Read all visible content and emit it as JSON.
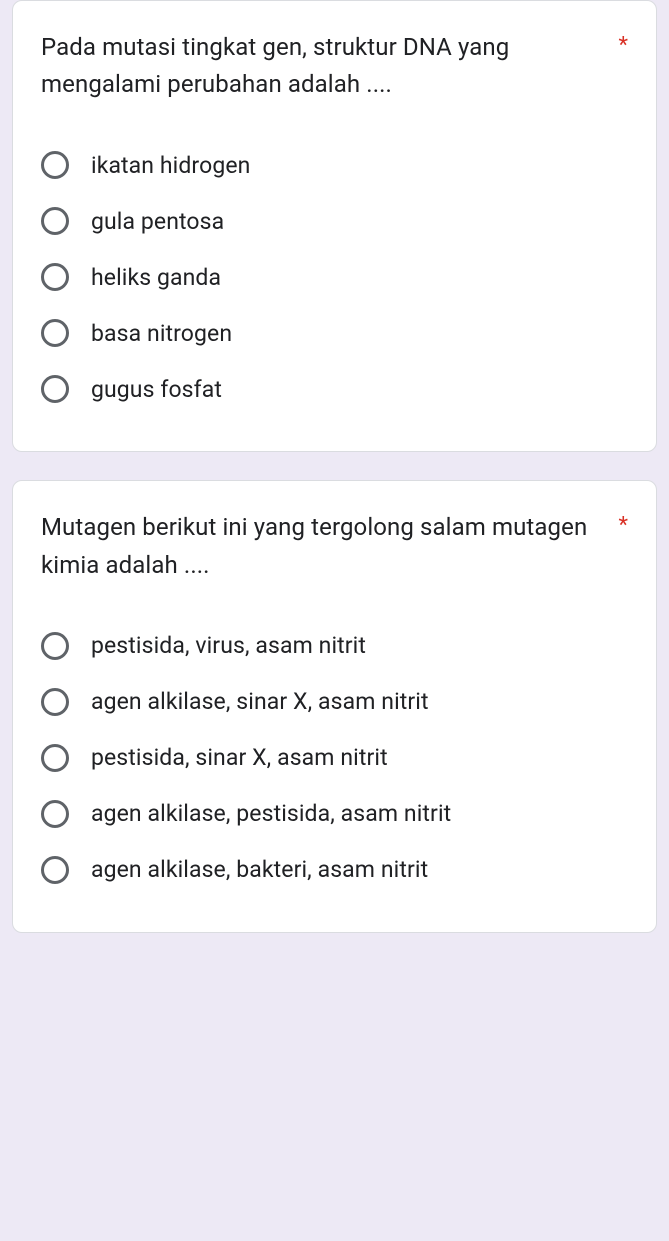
{
  "questions": [
    {
      "text": "Pada mutasi tingkat gen, struktur DNA yang mengalami perubahan adalah ....",
      "required": "*",
      "options": [
        "ikatan hidrogen",
        "gula pentosa",
        "heliks ganda",
        "basa nitrogen",
        "gugus fosfat"
      ]
    },
    {
      "text": "Mutagen berikut ini yang tergolong salam mutagen kimia adalah ....",
      "required": "*",
      "options": [
        "pestisida, virus, asam nitrit",
        "agen alkilase, sinar X, asam nitrit",
        "pestisida, sinar X, asam nitrit",
        "agen alkilase, pestisida, asam nitrit",
        "agen alkilase, bakteri, asam nitrit"
      ]
    }
  ]
}
